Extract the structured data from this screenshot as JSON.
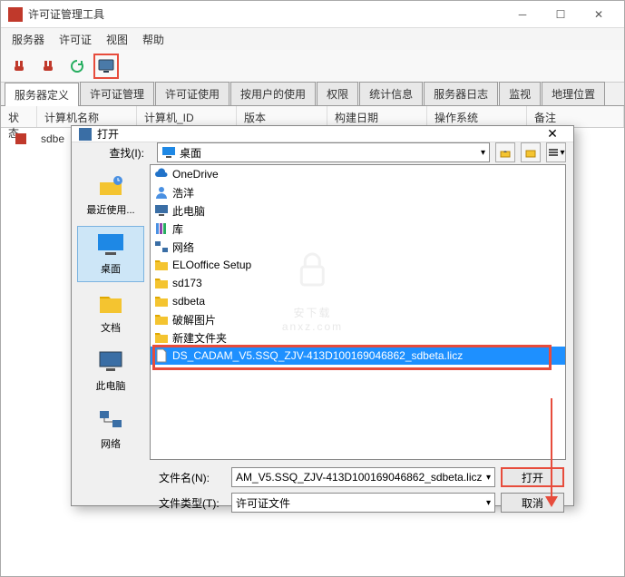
{
  "window": {
    "title": "许可证管理工具"
  },
  "menu": [
    "服务器",
    "许可证",
    "视图",
    "帮助"
  ],
  "tabs": [
    "服务器定义",
    "许可证管理",
    "许可证使用",
    "按用户的使用",
    "权限",
    "统计信息",
    "服务器日志",
    "监视",
    "地理位置"
  ],
  "columns": {
    "status": "状态",
    "name": "计算机名称",
    "id": "计算机_ID",
    "version": "版本",
    "date": "构建日期",
    "os": "操作系统",
    "note": "备注"
  },
  "row0": {
    "name": "sdbe"
  },
  "dialog": {
    "title": "打开",
    "lookin_label": "查找(I):",
    "lookin_value": "桌面",
    "places": {
      "recent": "最近使用...",
      "desktop": "桌面",
      "documents": "文档",
      "thispc": "此电脑",
      "network": "网络"
    },
    "files": [
      "OneDrive",
      "浩洋",
      "此电脑",
      "库",
      "网络",
      "ELOoffice Setup",
      "sd173",
      "sdbeta",
      "破解图片",
      "新建文件夹",
      "DS_CADAM_V5.SSQ_ZJV-413D100169046862_sdbeta.licz"
    ],
    "filename_label": "文件名(N):",
    "filename_value": "AM_V5.SSQ_ZJV-413D100169046862_sdbeta.licz",
    "filetype_label": "文件类型(T):",
    "filetype_value": "许可证文件",
    "open_btn": "打开",
    "cancel_btn": "取消"
  },
  "watermark": {
    "line1": "安下载",
    "line2": "anxz.com"
  }
}
